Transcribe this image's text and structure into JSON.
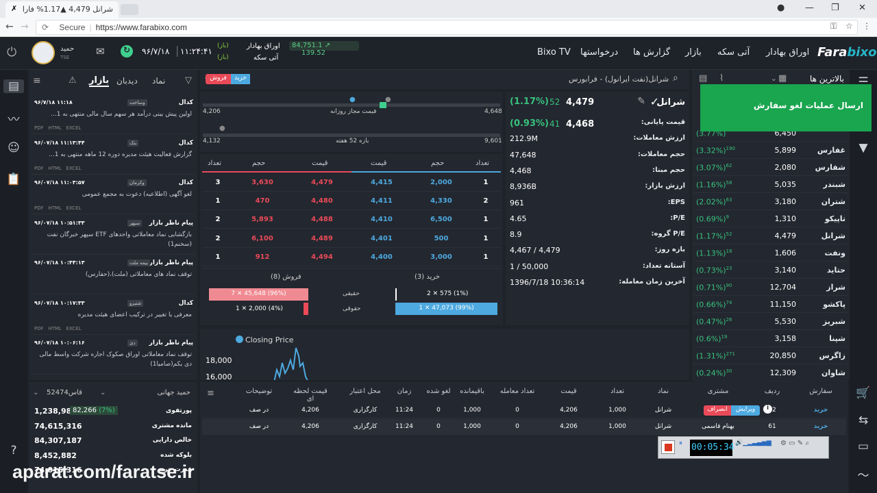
{
  "browser": {
    "tab_title": "شرانل 4,479 ▲1.17% فارا",
    "url_secure": "Secure",
    "url": "https://www.farabixo.com"
  },
  "header": {
    "logo_a": "Fara",
    "logo_b": "bixo",
    "nav": [
      "اوراق بهادار",
      "آتی سکه",
      "بازار",
      "گزارش ها",
      "درخواستها",
      "Bixo TV"
    ],
    "index_main": "84,751.1",
    "index_change": "139.52",
    "ticker1": "اوراق بهادار",
    "ticker2": "آتی سکه",
    "status1": "(باز)",
    "status2": "(باز)",
    "time": "۱۱:۲۴:۴۱",
    "date": "۹۶/۷/۱۸",
    "user_name": "حمید",
    "user_sub": "TSE"
  },
  "watchlist": {
    "title": "بالاترین ها",
    "rows": [
      {
        "name": "",
        "price": "6,450",
        "change": "(3.77%)",
        "qty": ""
      },
      {
        "name": "غفارس",
        "price": "5,899",
        "change": "(3.32%)",
        "qty": "190"
      },
      {
        "name": "شفارس",
        "price": "2,080",
        "change": "(3.07%)",
        "qty": "62"
      },
      {
        "name": "شبندر",
        "price": "5,035",
        "change": "(1.16%)",
        "qty": "58"
      },
      {
        "name": "شتران",
        "price": "3,180",
        "change": "(2.02%)",
        "qty": "63"
      },
      {
        "name": "تاپیکو",
        "price": "1,310",
        "change": "(0.69%)",
        "qty": "9"
      },
      {
        "name": "شرانل",
        "price": "4,479",
        "change": "(1.17%)",
        "qty": "52"
      },
      {
        "name": "ونفت",
        "price": "1,606",
        "change": "(1.13%)",
        "qty": "18"
      },
      {
        "name": "حتاید",
        "price": "3,140",
        "change": "(0.73%)",
        "qty": "23"
      },
      {
        "name": "شراز",
        "price": "12,704",
        "change": "(0.71%)",
        "qty": "90"
      },
      {
        "name": "پاکشو",
        "price": "11,150",
        "change": "(0.66%)",
        "qty": "74"
      },
      {
        "name": "شبریز",
        "price": "5,530",
        "change": "(0.47%)",
        "qty": "26"
      },
      {
        "name": "شپنا",
        "price": "3,158",
        "change": "(0.6%)",
        "qty": "19"
      },
      {
        "name": "زاگرس",
        "price": "20,850",
        "change": "(1.31%)",
        "qty": "271"
      },
      {
        "name": "شاوان",
        "price": "12,309",
        "change": "(0.24%)",
        "qty": "30"
      }
    ]
  },
  "popup": {
    "text": "ارسال عملیات لغو سفارش"
  },
  "symbol": {
    "search": "شرانل(نفت ایرانول) - فرابورس",
    "buy": "خرید",
    "sell": "فروش",
    "name": "شرانل",
    "last_price": "4,479",
    "last_change": "52",
    "last_pct": "(1.17%)",
    "close_price": "4,468",
    "close_change": "41",
    "close_pct": "(0.93%)"
  },
  "info": [
    {
      "label": "قیمت پایانی:",
      "value": ""
    },
    {
      "label": "ارزش معاملات:",
      "value": "212.9M"
    },
    {
      "label": "حجم معاملات:",
      "value": "47,648"
    },
    {
      "label": "حجم مبنا:",
      "value": "4,468"
    },
    {
      "label": "ارزش بازار:",
      "value": "8,936B"
    },
    {
      "label": "EPS:",
      "value": "961"
    },
    {
      "label": "P/E:",
      "value": "4.65"
    },
    {
      "label": "P/E گروه:",
      "value": "8.9"
    },
    {
      "label": "بازه روز:",
      "value": "4,467 / 4,479"
    },
    {
      "label": "آستانه تعداد:",
      "value": "1 / 50,000"
    },
    {
      "label": "آخرین زمان معامله:",
      "value": "1396/7/18 10:36:14"
    }
  ],
  "ranges": {
    "daily_label": "قیمت مجاز روزانه",
    "daily_min": "4,206",
    "daily_max": "4,648",
    "week_label": "بازه 52 هفته",
    "week_min": "4,132",
    "week_max": "9,601"
  },
  "orderbook": {
    "headers": [
      "تعداد",
      "حجم",
      "قیمت",
      "قیمت",
      "حجم",
      "تعداد"
    ],
    "rows": [
      {
        "sc": "3",
        "sv": "3,630",
        "sp": "4,479",
        "bp": "4,415",
        "bv": "2,000",
        "bc": "1"
      },
      {
        "sc": "1",
        "sv": "470",
        "sp": "4,480",
        "bp": "4,411",
        "bv": "4,330",
        "bc": "2"
      },
      {
        "sc": "2",
        "sv": "5,893",
        "sp": "4,488",
        "bp": "4,410",
        "bv": "6,500",
        "bc": "1"
      },
      {
        "sc": "2",
        "sv": "6,100",
        "sp": "4,489",
        "bp": "4,401",
        "bv": "500",
        "bc": "1"
      },
      {
        "sc": "1",
        "sv": "912",
        "sp": "4,494",
        "bp": "4,400",
        "bv": "3,000",
        "bc": "1"
      }
    ],
    "buy_total": "خرید (3)",
    "sell_total": "فروش (8)",
    "real": "حقیقی",
    "legal": "حقوقی",
    "buy_real": "2 ✕ 575 (1%)",
    "buy_legal": "1 ✕ 47,073 (99%)",
    "sell_real": "7 ✕ 45,648 (96%)",
    "sell_legal": "1 ✕ 2,000 (4%)"
  },
  "chart": {
    "legend": "Closing Price",
    "y1": "18,000",
    "y2": "16,000"
  },
  "news": {
    "tabs": [
      "بازار",
      "دیدبان",
      "نماد"
    ],
    "items": [
      {
        "title": "کدال",
        "tag": "وساخت",
        "time": "۹۶/۷/۱۸ ۱۱:۱۸",
        "body": "اولین پیش بینی درآمد هر سهم سال مالی منتهی به 1...",
        "fmt": "PDF   HTML   EXCEL"
      },
      {
        "title": "کدال",
        "tag": "بتک",
        "time": "۹۶/۰۷/۱۸ ۱۱:۱۳:۴۴",
        "body": "گزارش فعالیت هیئت مدیره دوره 12 ماهه منتهی به 1...",
        "fmt": "PDF   HTML   EXCEL"
      },
      {
        "title": "کدال",
        "tag": "وکرمان",
        "time": "۹۶/۰۷/۱۸ ۱۱:۰۳:۵۷",
        "body": "لغو آگهی (اطلاعیه) دعوت به مجمع عمومی",
        "fmt": "PDF   HTML   EXCEL"
      },
      {
        "title": "پیام ناظر بازار",
        "tag": "سپهر",
        "time": "۹۶/۰۷/۱۸ ۱۰:۵۱:۳۳",
        "body": "بازگشایی نماد معاملاتی واحدهای ETF سپهر خبرگان نفت (سخنم1)",
        "fmt": ""
      },
      {
        "title": "پیام ناظر بازار",
        "tag": "بیمه ملت",
        "time": "۹۶/۰۷/۱۸ ۱۰:۴۴:۱۳",
        "body": "توقف نماد های معاملاتی (ملت)،(حفارس)",
        "fmt": ""
      },
      {
        "title": "کدال",
        "tag": "شنیرو",
        "time": "۹۶/۰۷/۱۸ ۱۰:۱۷:۳۳",
        "body": "معرفی یا تغییر در ترکیب اعضای هیئت مدیره",
        "fmt": "PDF   HTML   EXCEL"
      },
      {
        "title": "پیام ناظر بازار",
        "tag": "دی",
        "time": "۹۶/۰۷/۱۸ ۱۰:۰۶:۱۶",
        "body": "توقف نماد معاملاتی اوراق صکوک اجاره شرکت واسط مالی دی یکم(صامیا1)",
        "fmt": ""
      }
    ]
  },
  "account": {
    "name": "حمید جهانی",
    "code": "قاس52474",
    "rows": [
      {
        "label": "پورتفوی",
        "value": "1,238,989",
        "extra": "82,266",
        "pct": "(7%)"
      },
      {
        "label": "مانده مشتری",
        "value": "74,615,316"
      },
      {
        "label": "خالص دارایی",
        "value": "84,307,187"
      },
      {
        "label": "بلوکه شده",
        "value": "8,452,882"
      },
      {
        "label": "قدرت خرید",
        "value": "74,015,316"
      }
    ]
  },
  "orders": {
    "headers": [
      "سفارش",
      "ردیف",
      "مشتری",
      "نماد",
      "تعداد",
      "قیمت",
      "تعداد معامله",
      "باقیمانده",
      "لغو شده",
      "زمان",
      "محل اعتبار",
      "قیمت لحظه ای",
      "توضیحات"
    ],
    "edit": "ویرایش",
    "cancel": "انصراف",
    "rows": [
      {
        "side": "خرید",
        "row": "62",
        "customer": "",
        "symbol": "شرانل",
        "qty": "1,000",
        "price": "4,206",
        "traded": "0",
        "remain": "1,000",
        "canceled": "0",
        "time": "11:24",
        "source": "کارگزاری",
        "live": "4,206",
        "desc": "در صف"
      },
      {
        "side": "خرید",
        "row": "61",
        "customer": "بهنام قاسمی",
        "symbol": "شرانل",
        "qty": "1,000",
        "price": "4,206",
        "traded": "0",
        "remain": "1,000",
        "canceled": "0",
        "time": "11:24",
        "source": "کارگزاری",
        "live": "4,206",
        "desc": "در صف"
      }
    ]
  },
  "recorder": {
    "timer": "00:05:34"
  },
  "watermark": "aparat.com/faratse.ir",
  "colors": {
    "buy": "#4da9e0",
    "sell": "#ea4a58",
    "green": "#38c27e",
    "popup": "#1aa54f",
    "bg": "#1e2229",
    "panel": "#23272f"
  }
}
